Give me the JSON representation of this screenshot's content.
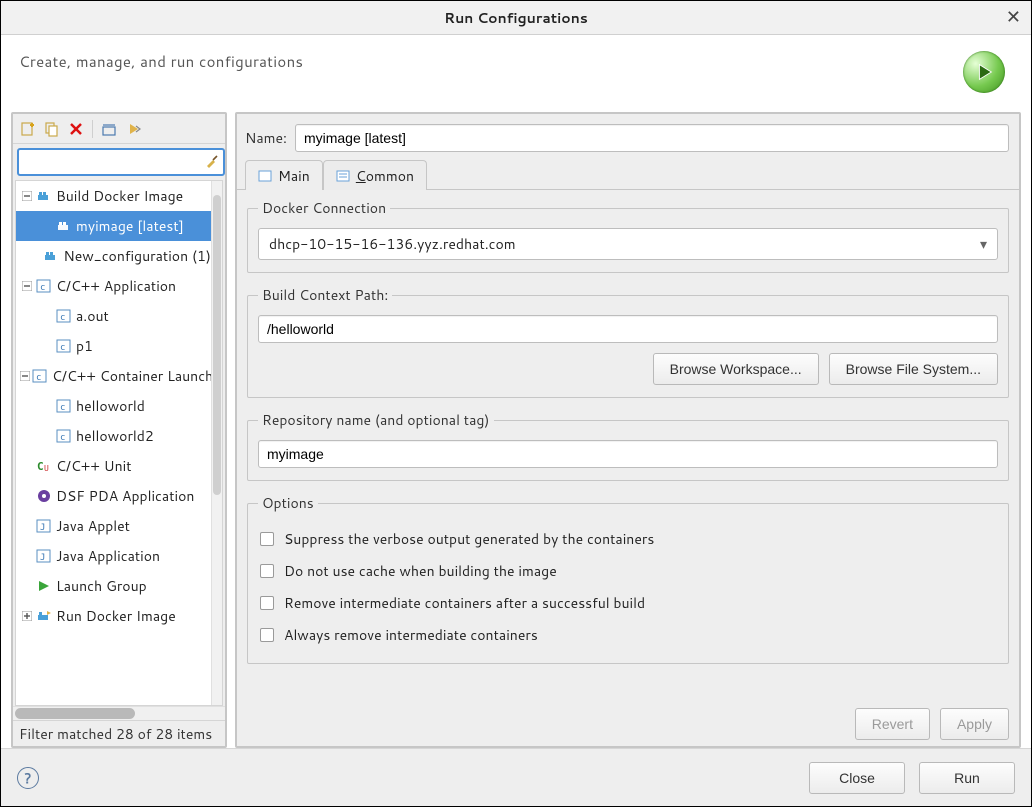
{
  "window": {
    "title": "Run Configurations"
  },
  "header": {
    "subtitle": "Create, manage, and run configurations"
  },
  "filter": {
    "placeholder": ""
  },
  "tree": {
    "items": [
      {
        "label": "Build Docker Image",
        "expandable": true,
        "expanded": true,
        "depth": 0,
        "icon": "docker-build",
        "selected": false
      },
      {
        "label": "myimage [latest]",
        "expandable": false,
        "depth": 1,
        "icon": "docker-build",
        "selected": true
      },
      {
        "label": "New_configuration (1)",
        "expandable": false,
        "depth": 1,
        "icon": "docker-build",
        "selected": false
      },
      {
        "label": "C/C++ Application",
        "expandable": true,
        "expanded": true,
        "depth": 0,
        "icon": "c-app",
        "selected": false
      },
      {
        "label": "a.out",
        "expandable": false,
        "depth": 1,
        "icon": "c-app",
        "selected": false
      },
      {
        "label": "p1",
        "expandable": false,
        "depth": 1,
        "icon": "c-app",
        "selected": false
      },
      {
        "label": "C/C++ Container Launcher",
        "expandable": true,
        "expanded": true,
        "depth": 0,
        "icon": "c-app",
        "selected": false
      },
      {
        "label": "helloworld",
        "expandable": false,
        "depth": 1,
        "icon": "c-app",
        "selected": false
      },
      {
        "label": "helloworld2",
        "expandable": false,
        "depth": 1,
        "icon": "c-app",
        "selected": false
      },
      {
        "label": "C/C++ Unit",
        "expandable": false,
        "depth": 0,
        "icon": "c-unit",
        "selected": false
      },
      {
        "label": "DSF PDA Application",
        "expandable": false,
        "depth": 0,
        "icon": "pda",
        "selected": false
      },
      {
        "label": "Java Applet",
        "expandable": false,
        "depth": 0,
        "icon": "java",
        "selected": false
      },
      {
        "label": "Java Application",
        "expandable": false,
        "depth": 0,
        "icon": "java",
        "selected": false
      },
      {
        "label": "Launch Group",
        "expandable": false,
        "depth": 0,
        "icon": "launch-group",
        "selected": false
      },
      {
        "label": "Run Docker Image",
        "expandable": true,
        "expanded": false,
        "depth": 0,
        "icon": "docker-run",
        "selected": false
      }
    ]
  },
  "status": {
    "text": "Filter matched 28 of 28 items"
  },
  "form": {
    "name_label": "Name:",
    "name_value": "myimage [latest]",
    "tabs": {
      "main": "Main",
      "common_prefix": "C",
      "common_rest": "ommon"
    },
    "docker_connection": {
      "legend": "Docker Connection",
      "value": "dhcp-10-15-16-136.yyz.redhat.com"
    },
    "build_context": {
      "legend": "Build Context Path:",
      "value": "/helloworld",
      "browse_workspace": "Browse Workspace...",
      "browse_filesystem": "Browse File System..."
    },
    "repo": {
      "legend": "Repository name (and optional tag)",
      "value": "myimage"
    },
    "options": {
      "legend": "Options",
      "opt1": "Suppress the verbose output generated by the containers",
      "opt2": "Do not use cache when building the image",
      "opt3": "Remove intermediate containers after a successful build",
      "opt4": "Always remove intermediate containers"
    },
    "revert": "Revert",
    "apply": "Apply"
  },
  "footer": {
    "close": "Close",
    "run": "Run"
  }
}
